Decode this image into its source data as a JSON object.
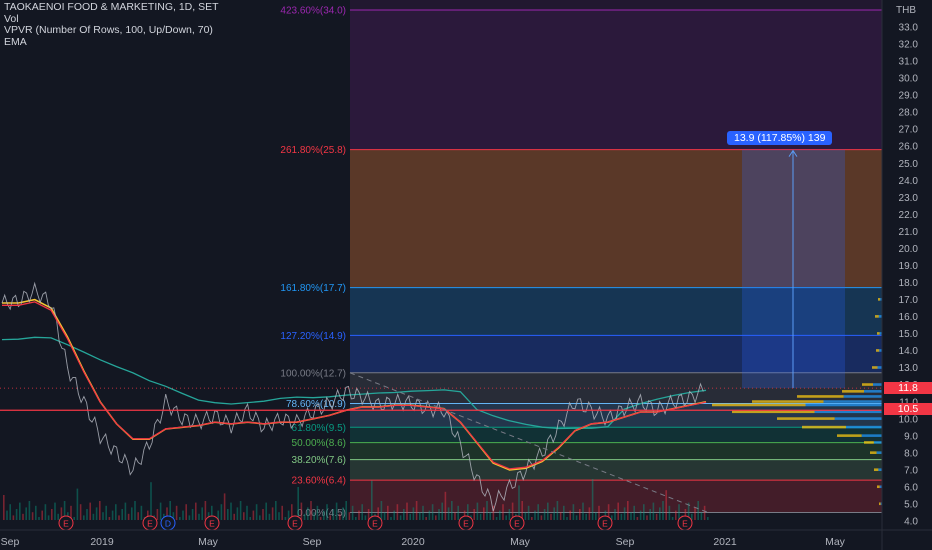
{
  "header": {
    "symbol_title": "TAOKAENOI FOOD & MARKETING, 1D, SET",
    "indicators": [
      "Vol",
      "VPVR (Number Of Rows, 100, Up/Down, 70)",
      "EMA"
    ]
  },
  "price_axis": {
    "currency": "THB",
    "ticks": [
      "4.0",
      "5.0",
      "6.0",
      "7.0",
      "8.0",
      "9.0",
      "10.0",
      "11.0",
      "12.0",
      "13.0",
      "14.0",
      "15.0",
      "16.0",
      "17.0",
      "18.0",
      "19.0",
      "20.0",
      "21.0",
      "22.0",
      "23.0",
      "24.0",
      "25.0",
      "26.0",
      "27.0",
      "28.0",
      "29.0",
      "30.0",
      "31.0",
      "32.0",
      "33.0"
    ],
    "current_price_tag": "11.8",
    "line_price_tag": "10.5"
  },
  "time_axis": {
    "labels": [
      "Sep",
      "2019",
      "May",
      "Sep",
      "2020",
      "May",
      "Sep",
      "2021",
      "May"
    ]
  },
  "fib_levels": [
    {
      "label": "0.00%(4.5)",
      "color": "#787b86"
    },
    {
      "label": "23.60%(6.4)",
      "color": "#f23645"
    },
    {
      "label": "38.20%(7.6)",
      "color": "#81c784"
    },
    {
      "label": "50.00%(8.6)",
      "color": "#4caf50"
    },
    {
      "label": "61.80%(9.5)",
      "color": "#089981"
    },
    {
      "label": "78.60%(10.9)",
      "color": "#64b5f6"
    },
    {
      "label": "100.00%(12.7)",
      "color": "#787b86"
    },
    {
      "label": "127.20%(14.9)",
      "color": "#2962ff"
    },
    {
      "label": "161.80%(17.7)",
      "color": "#2196f3"
    },
    {
      "label": "261.80%(25.8)",
      "color": "#f23645"
    },
    {
      "label": "423.60%(34.0)",
      "color": "#9c27b0"
    }
  ],
  "measure": {
    "label": "13.9 (117.85%) 139"
  },
  "earnings_markers": [
    "E",
    "E",
    "D",
    "E",
    "E",
    "E",
    "E",
    "E",
    "E",
    "E"
  ],
  "chart_data": {
    "type": "line",
    "title": "TAOKAENOI FOOD & MARKETING, 1D, SET",
    "xlabel": "",
    "ylabel": "",
    "ylim": [
      3.5,
      34.5
    ],
    "x_labels": [
      "Sep",
      "2019",
      "May",
      "Sep",
      "2020",
      "May",
      "Sep",
      "2021",
      "May"
    ],
    "series": [
      {
        "name": "price",
        "values": [
          16.8,
          16.9,
          17.5,
          16.8,
          13.0,
          11.0,
          9.0,
          8.0,
          7.0,
          8.5,
          11.0,
          10.0,
          9.8,
          10.2,
          9.6,
          10.5,
          9.5,
          10.0,
          9.8,
          10.4,
          10.9,
          11.6,
          11.3,
          10.8,
          11.0,
          10.9,
          10.6,
          10.5,
          8.5,
          6.5,
          5.0,
          6.0,
          7.0,
          8.0,
          9.5,
          11.0,
          10.5,
          10.0,
          10.6,
          11.0,
          10.5,
          11.0,
          11.2,
          11.8
        ]
      },
      {
        "name": "EMA",
        "values": [
          16.8,
          16.8,
          17.0,
          16.5,
          14.8,
          12.8,
          11.0,
          9.7,
          8.8,
          8.8,
          9.4,
          9.5,
          9.6,
          9.8,
          9.7,
          9.8,
          9.7,
          9.8,
          9.8,
          10.0,
          10.2,
          10.5,
          10.7,
          10.7,
          10.8,
          10.8,
          10.7,
          10.6,
          9.8,
          8.6,
          7.4,
          7.0,
          7.1,
          7.5,
          8.3,
          9.3,
          9.7,
          9.8,
          10.1,
          10.4,
          10.4,
          10.6,
          10.8,
          11.0
        ]
      }
    ],
    "fib_levels": [
      4.5,
      6.4,
      7.6,
      8.6,
      9.5,
      10.9,
      12.7,
      14.9,
      17.7,
      25.8,
      34.0
    ],
    "current_price": 11.8,
    "horizontal_line": 10.5,
    "measure": {
      "from": 11.8,
      "to": 25.8,
      "change": 13.9,
      "percent": 117.85,
      "bars": 139
    }
  }
}
